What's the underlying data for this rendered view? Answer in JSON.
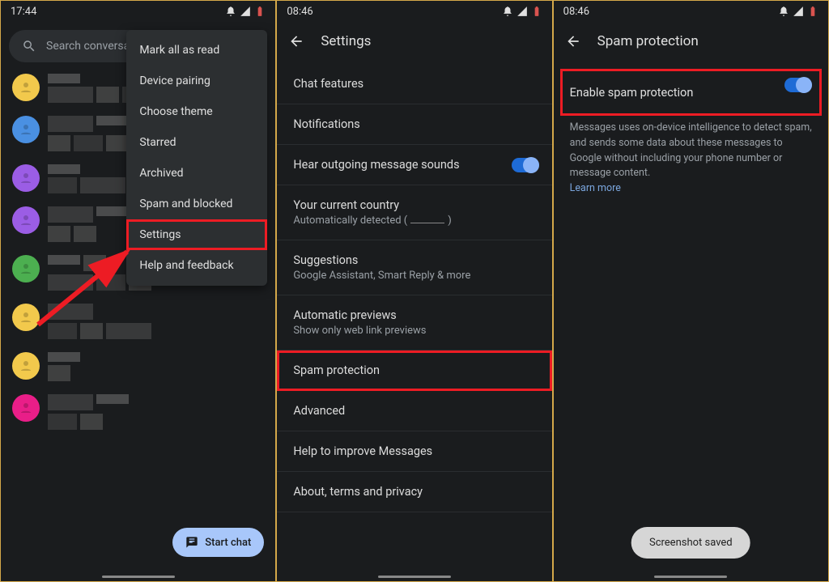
{
  "panel1": {
    "time": "17:44",
    "search_placeholder": "Search conversat",
    "menu": {
      "mark_all": "Mark all as read",
      "device_pairing": "Device pairing",
      "choose_theme": "Choose theme",
      "starred": "Starred",
      "archived": "Archived",
      "spam_blocked": "Spam and blocked",
      "settings": "Settings",
      "help": "Help and feedback"
    },
    "fab_label": "Start chat",
    "avatar_colors": [
      "#f2c94c",
      "#4a90e2",
      "#9b5de5",
      "#9b5de5",
      "#4caf50",
      "#f2c94c",
      "#f2c94c",
      "#e91e88"
    ]
  },
  "panel2": {
    "time": "08:46",
    "title": "Settings",
    "items": {
      "chat_features": "Chat features",
      "notifications": "Notifications",
      "hear_outgoing": "Hear outgoing message sounds",
      "country_title": "Your current country",
      "country_sub_prefix": "Automatically detected (",
      "country_sub_suffix": ")",
      "suggestions_title": "Suggestions",
      "suggestions_sub": "Google Assistant, Smart Reply & more",
      "previews_title": "Automatic previews",
      "previews_sub": "Show only web link previews",
      "spam_protection": "Spam protection",
      "advanced": "Advanced",
      "help_improve": "Help to improve Messages",
      "about": "About, terms and privacy"
    }
  },
  "panel3": {
    "time": "08:46",
    "title": "Spam protection",
    "toggle_label": "Enable spam protection",
    "desc": "Messages uses on-device intelligence to detect spam, and sends some data about these messages to Google without including your phone number or message content.",
    "learn_more": "Learn more",
    "toast": "Screenshot saved"
  }
}
